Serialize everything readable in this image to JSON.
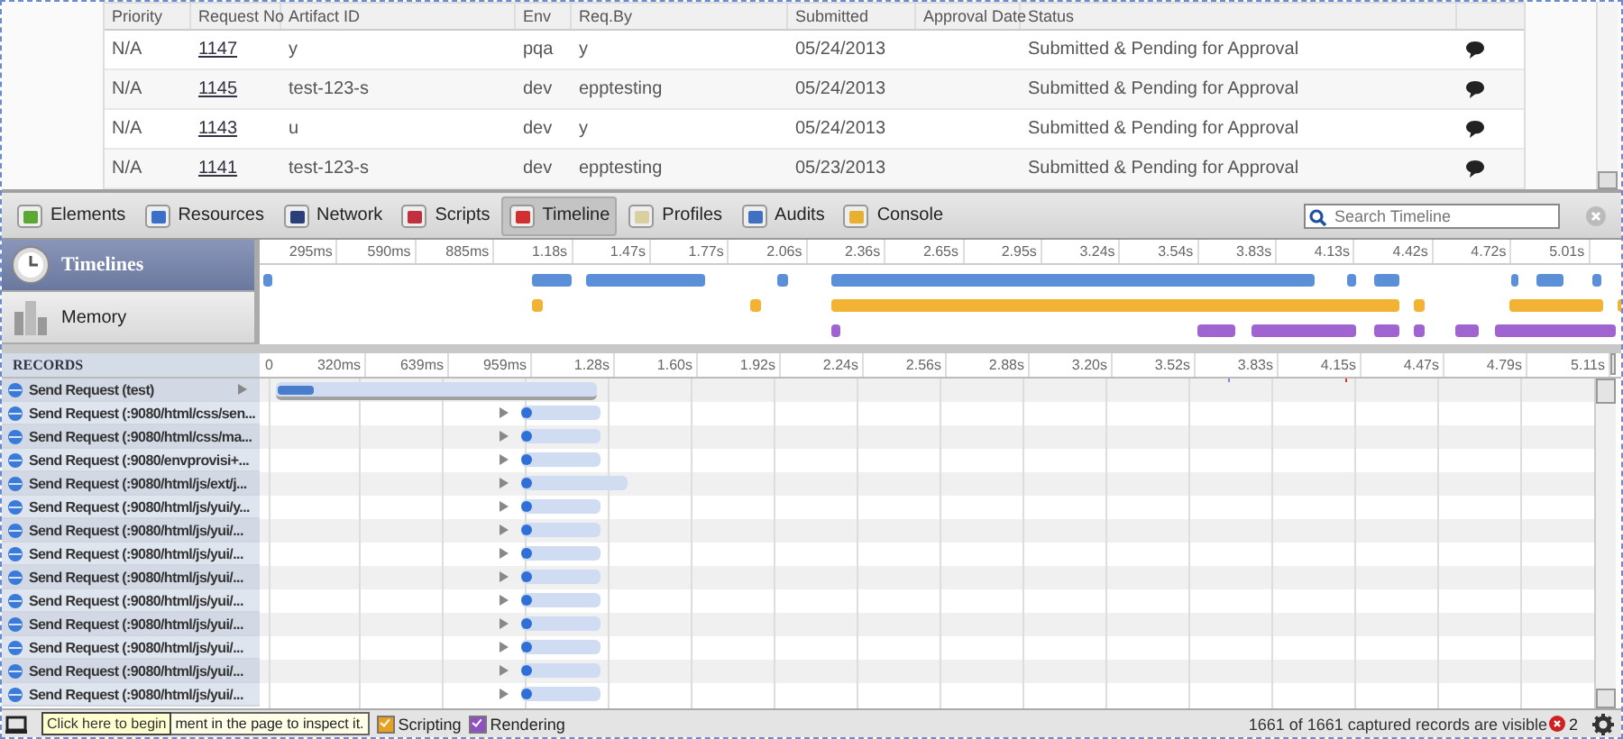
{
  "page_table": {
    "columns": [
      "Priority",
      "Request No",
      "Artifact ID",
      "Env",
      "Req.By",
      "Submitted",
      "Approval Date",
      "Status"
    ],
    "rows": [
      {
        "cells": [
          "N/A",
          "1147",
          "y",
          "pqa",
          "y",
          "05/24/2013",
          "",
          "Submitted & Pending for Approval"
        ]
      },
      {
        "cells": [
          "N/A",
          "1145",
          "test-123-s",
          "dev",
          "epptesting",
          "05/24/2013",
          "",
          "Submitted & Pending for Approval"
        ]
      },
      {
        "cells": [
          "N/A",
          "1143",
          "u",
          "dev",
          "y",
          "05/24/2013",
          "",
          "Submitted & Pending for Approval"
        ]
      },
      {
        "cells": [
          "N/A",
          "1141",
          "test-123-s",
          "dev",
          "epptesting",
          "05/23/2013",
          "",
          "Submitted & Pending for Approval"
        ]
      }
    ]
  },
  "tabs": [
    {
      "label": "Elements",
      "kind": "elements",
      "selected": false
    },
    {
      "label": "Resources",
      "kind": "resources",
      "selected": false
    },
    {
      "label": "Network",
      "kind": "network",
      "selected": false
    },
    {
      "label": "Scripts",
      "kind": "scripts",
      "selected": false
    },
    {
      "label": "Timeline",
      "kind": "timeline",
      "selected": true
    },
    {
      "label": "Profiles",
      "kind": "profiles",
      "selected": false
    },
    {
      "label": "Audits",
      "kind": "audits",
      "selected": false
    },
    {
      "label": "Console",
      "kind": "console",
      "selected": false
    }
  ],
  "search": {
    "placeholder": "Search Timeline"
  },
  "overview": {
    "items": [
      {
        "label": "Timelines",
        "kind": "timelines",
        "selected": true
      },
      {
        "label": "Memory",
        "kind": "memory",
        "selected": false
      }
    ],
    "ticks": [
      "295ms",
      "590ms",
      "885ms",
      "1.18s",
      "1.47s",
      "1.77s",
      "2.06s",
      "2.36s",
      "2.65s",
      "2.95s",
      "3.24s",
      "3.54s",
      "3.83s",
      "4.13s",
      "4.42s",
      "4.72s",
      "5.01s"
    ]
  },
  "records": {
    "title": "RECORDS",
    "origin": "0",
    "ticks": [
      "320ms",
      "639ms",
      "959ms",
      "1.28s",
      "1.60s",
      "1.92s",
      "2.24s",
      "2.56s",
      "2.88s",
      "3.20s",
      "3.52s",
      "3.83s",
      "4.15s",
      "4.47s",
      "4.79s",
      "5.11s"
    ],
    "rows": [
      {
        "label": "Send Request (test)",
        "kind": "page"
      },
      {
        "label": "Send Request (:9080/html/css/sen...",
        "kind": "resource"
      },
      {
        "label": "Send Request (:9080/html/css/ma...",
        "kind": "resource"
      },
      {
        "label": "Send Request (:9080/envprovisi+...",
        "kind": "resource"
      },
      {
        "label": "Send Request (:9080/html/js/ext/j...",
        "kind": "long"
      },
      {
        "label": "Send Request (:9080/html/js/yui/y...",
        "kind": "resource"
      },
      {
        "label": "Send Request (:9080/html/js/yui/...",
        "kind": "resource"
      },
      {
        "label": "Send Request (:9080/html/js/yui/...",
        "kind": "resource"
      },
      {
        "label": "Send Request (:9080/html/js/yui/...",
        "kind": "resource"
      },
      {
        "label": "Send Request (:9080/html/js/yui/...",
        "kind": "resource"
      },
      {
        "label": "Send Request (:9080/html/js/yui/...",
        "kind": "resource"
      },
      {
        "label": "Send Request (:9080/html/js/yui/...",
        "kind": "resource"
      },
      {
        "label": "Send Request (:9080/html/js/yui/...",
        "kind": "resource"
      },
      {
        "label": "Send Request (:9080/html/js/yui/...",
        "kind": "resource"
      }
    ]
  },
  "status_bar": {
    "tooltip": "Click here to begin",
    "hint": "ment in the page to inspect it.",
    "filters": [
      {
        "label": "Scripting",
        "checked": true,
        "color": "#e8a020"
      },
      {
        "label": "Rendering",
        "checked": true,
        "color": "#9050c0"
      }
    ],
    "summary": "1661 of 1661 captured records are visible",
    "errors": "2"
  }
}
